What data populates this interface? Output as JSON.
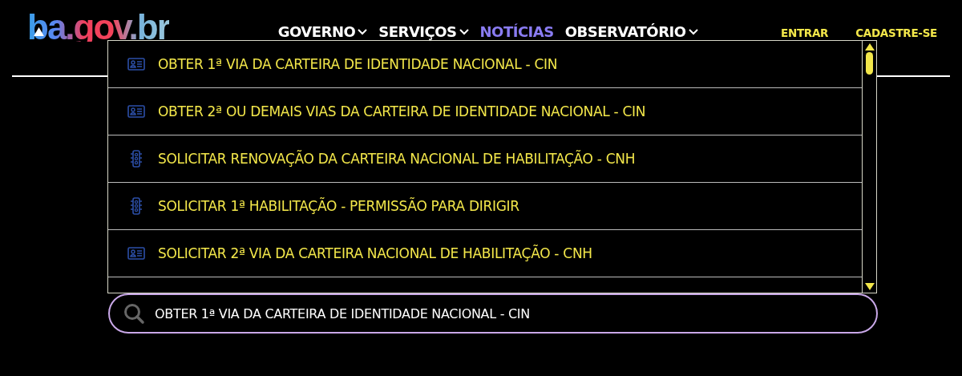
{
  "logo": {
    "text": "ba.gov.br"
  },
  "nav": [
    {
      "label": "GOVERNO",
      "has_menu": true,
      "selected": false
    },
    {
      "label": "SERVIÇOS",
      "has_menu": true,
      "selected": false
    },
    {
      "label": "NOTÍCIAS",
      "has_menu": false,
      "selected": true
    },
    {
      "label": "OBSERVATÓRIO",
      "has_menu": true,
      "selected": false
    }
  ],
  "account_links": [
    "ENTRAR",
    "CADASTRE-SE"
  ],
  "suggestions": [
    {
      "kind": "id-card",
      "label": "OBTER 1ª VIA DA CARTEIRA DE IDENTIDADE NACIONAL - CIN"
    },
    {
      "kind": "id-card",
      "label": "OBTER 2ª OU DEMAIS VIAS DA CARTEIRA DE IDENTIDADE NACIONAL - CIN"
    },
    {
      "kind": "traffic-light",
      "label": "SOLICITAR RENOVAÇÃO DA CARTEIRA NACIONAL DE HABILITAÇÃO - CNH"
    },
    {
      "kind": "traffic-light",
      "label": "SOLICITAR 1ª HABILITAÇÃO - PERMISSÃO PARA DIRIGIR"
    },
    {
      "kind": "id-card",
      "label": "SOLICITAR 2ª VIA DA CARTEIRA NACIONAL DE HABILITAÇÃO - CNH"
    }
  ],
  "search": {
    "value": "OBTER 1ª VIA DA CARTEIRA DE IDENTIDADE NACIONAL - CIN"
  }
}
